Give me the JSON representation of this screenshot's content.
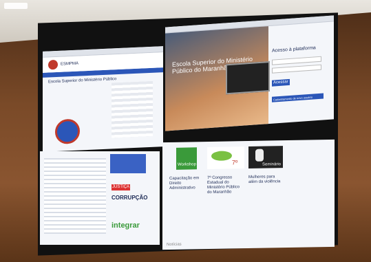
{
  "screens": {
    "top_left": {
      "logo": "ESMPMA",
      "heading": "Escola Superior do Ministério Público"
    },
    "top_right": {
      "hero_title": "Escola Superior do Ministério Público do Maranhão",
      "login_title": "Acesso à plataforma",
      "button_login": "Acessar",
      "button_register": "Cadastramento de novo usuário"
    },
    "bottom_left": {
      "banner_1": "JUSTIÇA",
      "banner_2": "CORRUPÇÃO",
      "banner_3": "integrar"
    },
    "bottom_right": {
      "card_1_tag": "Workshop",
      "card_1_text": "Capacitação em Direito Administrativo",
      "card_2_tag": "7º",
      "card_2_text": "7º Congresso Estadual do Ministério Público do Maranhão",
      "card_3_tag": "Seminário",
      "card_3_text": "Mulheres para além da violência",
      "footer": "Notícias"
    }
  },
  "colors": {
    "accent": "#2b56b8",
    "wood": "#7a4a28",
    "green": "#3a9a3a"
  }
}
